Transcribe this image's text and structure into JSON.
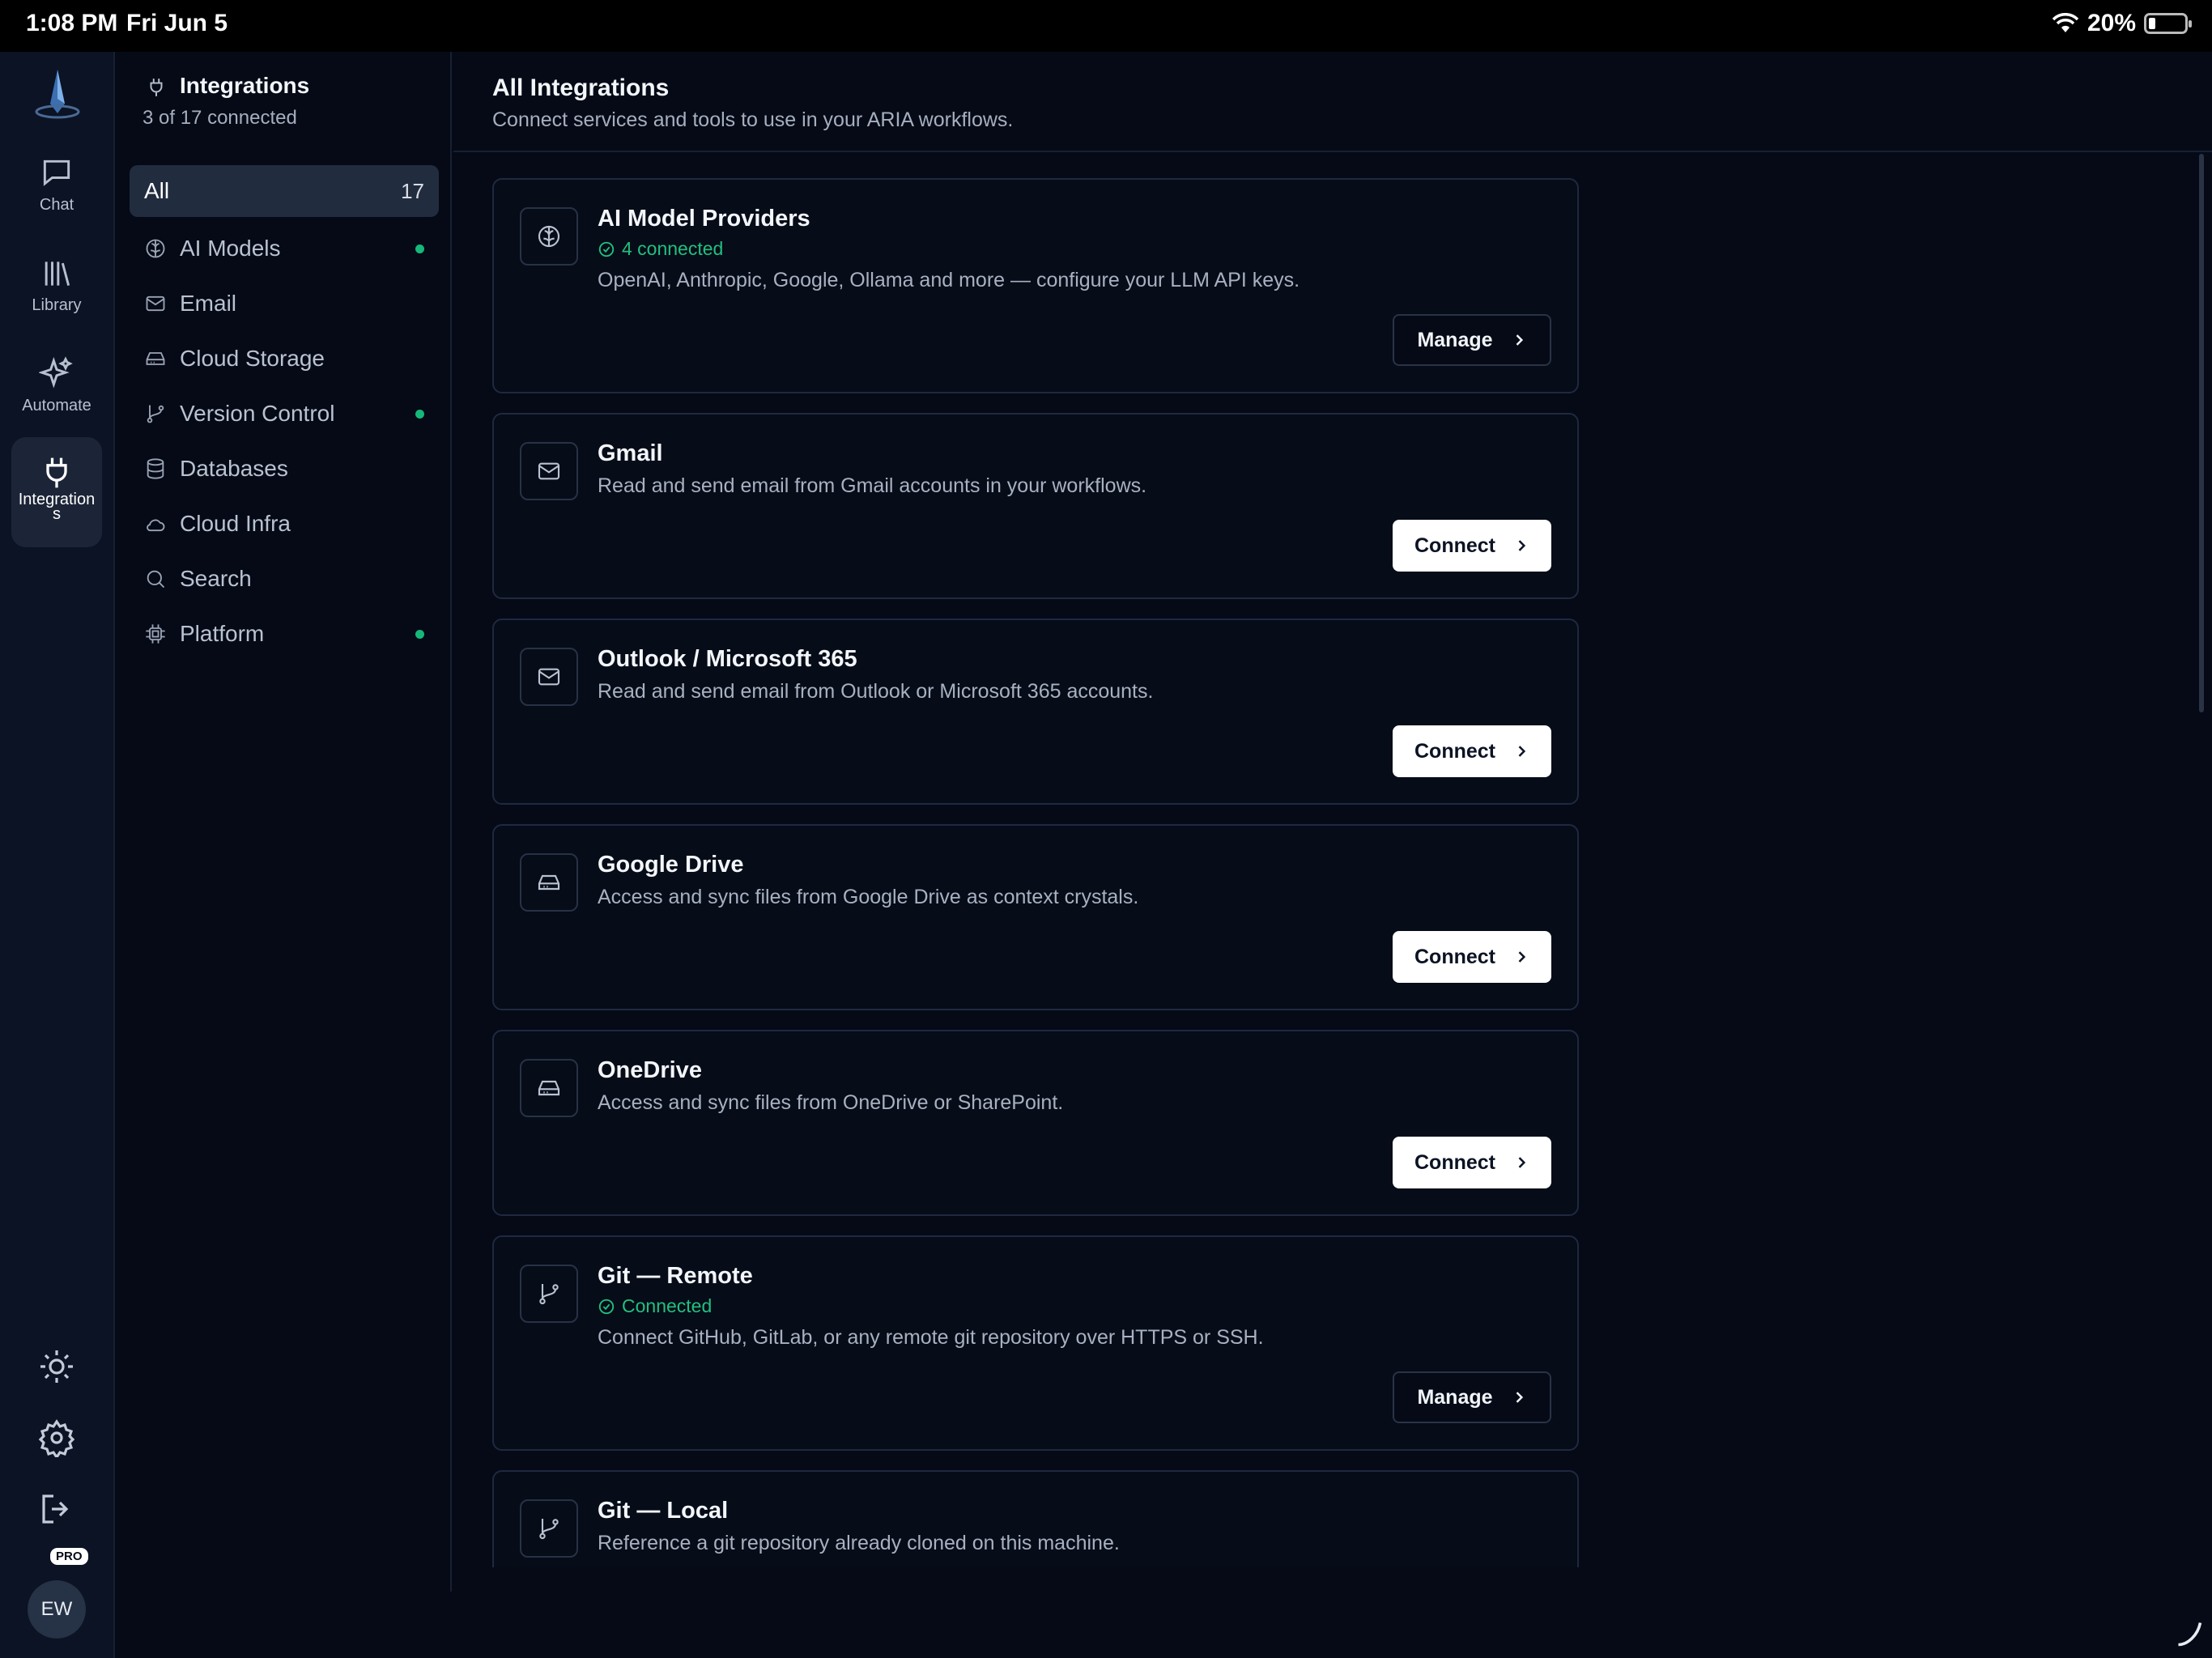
{
  "status_bar": {
    "time": "1:08 PM",
    "date": "Fri Jun 5",
    "battery": "20%"
  },
  "rail": {
    "items": [
      {
        "label": "Chat",
        "icon": "chat-icon"
      },
      {
        "label": "Library",
        "icon": "library-icon"
      },
      {
        "label": "Automate",
        "icon": "sparkle-icon"
      },
      {
        "label": "Integration\ns",
        "icon": "plug-icon",
        "active": true
      }
    ],
    "bottom_icons": [
      "sun-icon",
      "gear-icon",
      "logout-icon"
    ],
    "avatar_initials": "EW",
    "badge": "PRO"
  },
  "sidebar": {
    "title": "Integrations",
    "subtitle": "3 of 17 connected",
    "categories": [
      {
        "label": "All",
        "count": "17",
        "active": true
      },
      {
        "label": "AI Models",
        "icon": "brain-icon",
        "connected": true
      },
      {
        "label": "Email",
        "icon": "mail-icon",
        "connected": false
      },
      {
        "label": "Cloud Storage",
        "icon": "drive-icon",
        "connected": false
      },
      {
        "label": "Version Control",
        "icon": "git-branch-icon",
        "connected": true
      },
      {
        "label": "Databases",
        "icon": "database-icon",
        "connected": false
      },
      {
        "label": "Cloud Infra",
        "icon": "cloud-icon",
        "connected": false
      },
      {
        "label": "Search",
        "icon": "search-icon",
        "connected": false
      },
      {
        "label": "Platform",
        "icon": "cpu-icon",
        "connected": true
      }
    ]
  },
  "main": {
    "title": "All Integrations",
    "subtitle": "Connect services and tools to use in your ARIA workflows.",
    "cards": [
      {
        "title": "AI Model Providers",
        "status": "4 connected",
        "desc": "OpenAI, Anthropic, Google, Ollama and more — configure your LLM API keys.",
        "button": "Manage",
        "icon": "brain-icon"
      },
      {
        "title": "Gmail",
        "status": "",
        "desc": "Read and send email from Gmail accounts in your workflows.",
        "button": "Connect",
        "icon": "mail-icon"
      },
      {
        "title": "Outlook / Microsoft 365",
        "status": "",
        "desc": "Read and send email from Outlook or Microsoft 365 accounts.",
        "button": "Connect",
        "icon": "mail-icon"
      },
      {
        "title": "Google Drive",
        "status": "",
        "desc": "Access and sync files from Google Drive as context crystals.",
        "button": "Connect",
        "icon": "drive-icon"
      },
      {
        "title": "OneDrive",
        "status": "",
        "desc": "Access and sync files from OneDrive or SharePoint.",
        "button": "Connect",
        "icon": "drive-icon"
      },
      {
        "title": "Git — Remote",
        "status": "Connected",
        "desc": "Connect GitHub, GitLab, or any remote git repository over HTTPS or SSH.",
        "button": "Manage",
        "icon": "git-branch-icon"
      },
      {
        "title": "Git — Local",
        "status": "",
        "desc": "Reference a git repository already cloned on this machine.",
        "button": "",
        "icon": "git-branch-icon"
      }
    ]
  }
}
